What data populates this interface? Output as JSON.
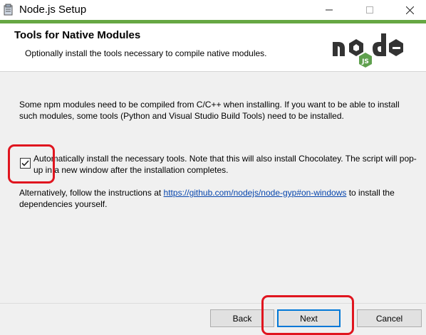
{
  "window": {
    "title": "Node.js Setup",
    "icon": "installer-icon"
  },
  "header": {
    "title": "Tools for Native Modules",
    "subtitle": "Optionally install the tools necessary to compile native modules.",
    "logo": "node-js-logo"
  },
  "content": {
    "paragraph": "Some npm modules need to be compiled from C/C++ when installing. If you want to be able to install such modules, some tools (Python and Visual Studio Build Tools) need to be installed.",
    "checkbox": {
      "checked": true,
      "label": "Automatically install the necessary tools. Note that this will also install Chocolatey. The script will pop-up in a new window after the installation completes."
    },
    "alternative_prefix": "Alternatively, follow the instructions at ",
    "alternative_link": "https://github.com/nodejs/node-gyp#on-windows",
    "alternative_suffix": " to install the dependencies yourself."
  },
  "buttons": {
    "back": "Back",
    "next": "Next",
    "cancel": "Cancel"
  },
  "colors": {
    "accent": "#66a743",
    "highlight": "#e0151f",
    "link": "#0645ad",
    "focus": "#0078d7"
  }
}
